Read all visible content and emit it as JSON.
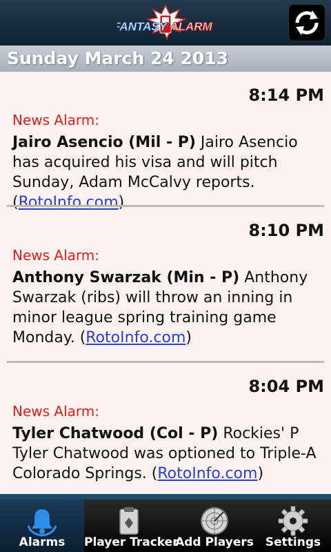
{
  "header": {
    "logo_text": "FANTASY ALARM",
    "refresh_icon": "refresh-icon"
  },
  "date": "Sunday March 24 2013",
  "news": [
    {
      "time": "8:14 PM",
      "label": "News Alarm:",
      "player": "Jairo Asencio (Mil - P)",
      "text": " Jairo Asencio has acquired his visa and will pitch Sunday, Adam McCalvy reports. (",
      "link": "RotoInfo.com",
      "close": ")"
    },
    {
      "time": "8:10 PM",
      "label": "News Alarm:",
      "player": "Anthony Swarzak (Min - P)",
      "text": " Anthony Swarzak (ribs) will throw an inning in minor league spring training game Monday. (",
      "link": "RotoInfo.com",
      "close": ")"
    },
    {
      "time": "8:04 PM",
      "label": "News Alarm:",
      "player": "Tyler Chatwood (Col - P)",
      "text": " Rockies' P Tyler Chatwood was optioned to Triple-A Colorado Springs. (",
      "link": "RotoInfo.com",
      "close": ")"
    }
  ],
  "tabs": [
    {
      "label": "Alarms",
      "icon": "bell-icon",
      "active": true
    },
    {
      "label": "Player Tracker",
      "icon": "clipboard-icon",
      "active": false
    },
    {
      "label": "Add Players",
      "icon": "radar-icon",
      "active": false
    },
    {
      "label": "Settings",
      "icon": "gear-icon",
      "active": false
    }
  ],
  "colors": {
    "news_label": "#e21b1b",
    "link": "#2a3fcf",
    "feed_background": "#fcf3f1",
    "active_tab": "#1a3b5b"
  }
}
